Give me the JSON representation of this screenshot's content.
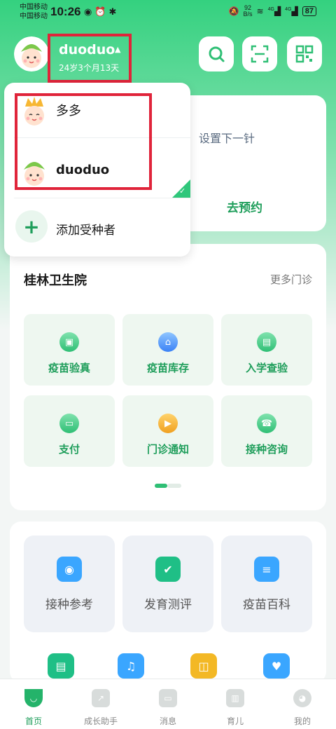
{
  "status_bar": {
    "carrier1": "中国移动",
    "carrier2": "中国移动",
    "time": "10:26",
    "net_speed_value": "92",
    "net_speed_unit": "B/s",
    "signal1": "4G",
    "signal2": "4G",
    "battery": "87"
  },
  "header": {
    "profile_name": "duoduo",
    "profile_age": "24岁3个月13天"
  },
  "dropdown": {
    "items": [
      {
        "label": "多多"
      },
      {
        "label": "duoduo"
      }
    ],
    "add_label": "添加受种者"
  },
  "appointment_card": {
    "next_dose": "设置下一针",
    "book_label": "去预约"
  },
  "hospital": {
    "title": "桂林卫生院",
    "more": "更多门诊",
    "tiles": [
      {
        "label": "疫苗验真"
      },
      {
        "label": "疫苗库存"
      },
      {
        "label": "入学查验"
      },
      {
        "label": "支付"
      },
      {
        "label": "门诊通知"
      },
      {
        "label": "接种咨询"
      }
    ]
  },
  "tools": [
    {
      "label": "接种参考"
    },
    {
      "label": "发育测评"
    },
    {
      "label": "疫苗百科"
    }
  ],
  "tabbar": [
    {
      "label": "首页"
    },
    {
      "label": "成长助手"
    },
    {
      "label": "消息"
    },
    {
      "label": "育儿"
    },
    {
      "label": "我的"
    }
  ],
  "colors": {
    "brand": "#2fbf75",
    "highlight_box": "#e0243a"
  }
}
